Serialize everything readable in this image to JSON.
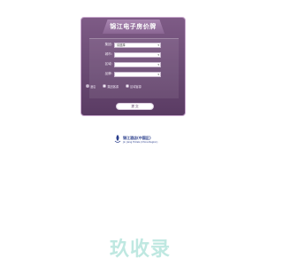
{
  "panel": {
    "title": "锦江电子房价牌",
    "fields": [
      {
        "label": "集团:",
        "value": "请选择"
      },
      {
        "label": "城市:",
        "value": ""
      },
      {
        "label": "区域:",
        "value": ""
      },
      {
        "label": "品牌:",
        "value": ""
      }
    ],
    "options": [
      {
        "label": "酒店",
        "selected": true
      },
      {
        "label": "集团客源",
        "selected": false
      },
      {
        "label": "区域客源",
        "selected": false
      }
    ],
    "submit_label": "提 交"
  },
  "logo": {
    "brand_cn": "锦江酒店(中国区)",
    "brand_en": "Jin Jiang Hotels (China Region)"
  },
  "watermark": {
    "text": "玖收录"
  },
  "colors": {
    "panel_purple": "#6a4a73",
    "brand_blue": "#2a3e8c",
    "watermark": "#bfe8e1"
  }
}
